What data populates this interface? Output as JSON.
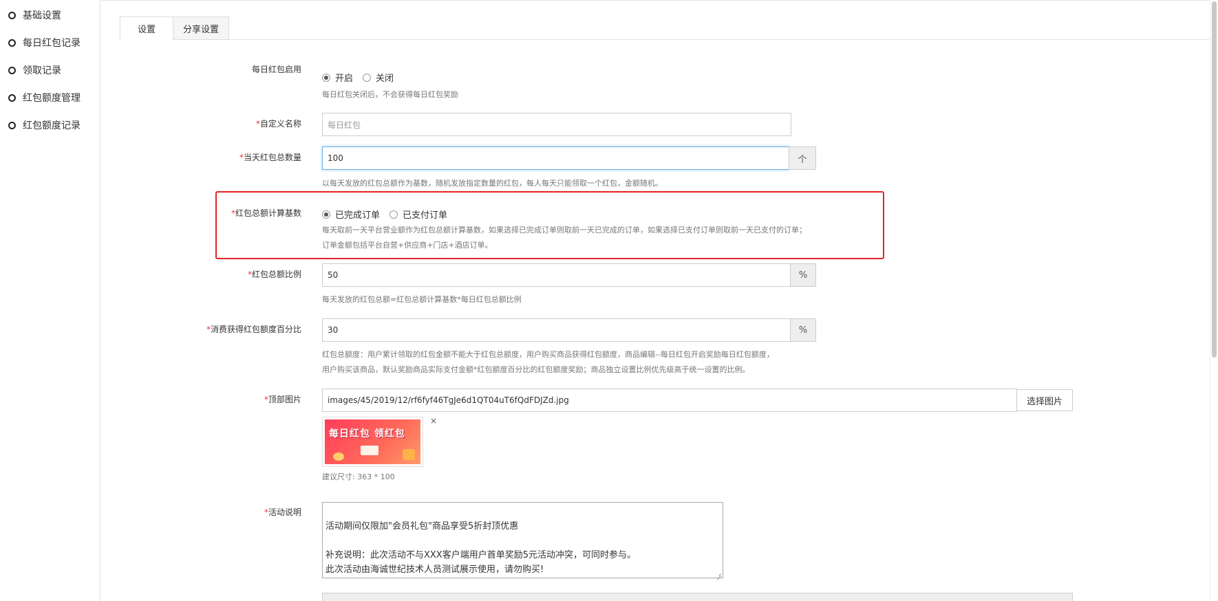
{
  "sidebar": {
    "items": [
      {
        "label": "基础设置"
      },
      {
        "label": "每日红包记录"
      },
      {
        "label": "领取记录"
      },
      {
        "label": "红包额度管理"
      },
      {
        "label": "红包额度记录"
      }
    ]
  },
  "tabs": [
    {
      "label": "设置",
      "active": true
    },
    {
      "label": "分享设置",
      "active": false
    }
  ],
  "form": {
    "daily_enable": {
      "label": "每日红包启用",
      "options": [
        "开启",
        "关闭"
      ],
      "selected": "开启",
      "hint": "每日红包关闭后，不会获得每日红包奖励"
    },
    "custom_name": {
      "label": "自定义名称",
      "placeholder": "每日红包"
    },
    "total_count": {
      "label": "当天红包总数量",
      "value": "100",
      "addon": "个",
      "hint": "以每天发放的红包总额作为基数，随机发放指定数量的红包，每人每天只能领取一个红包，金额随机。"
    },
    "calc_base": {
      "label": "红包总额计算基数",
      "options": [
        "已完成订单",
        "已支付订单"
      ],
      "selected": "已完成订单",
      "hint1": "每天取前一天平台营业额作为红包总额计算基数，如果选择已完成订单则取前一天已完成的订单，如果选择已支付订单则取前一天已支付的订单；",
      "hint2": "订单金额包括平台自营+供应商+门店+酒店订单。"
    },
    "ratio": {
      "label": "红包总额比例",
      "value": "50",
      "addon": "%",
      "hint": "每天发放的红包总额=红包总额计算基数*每日红包总额比例"
    },
    "consume_percent": {
      "label": "消费获得红包额度百分比",
      "value": "30",
      "addon": "%",
      "hint1": "红包总额度：用户累计领取的红包金额不能大于红包总额度，用户购买商品获得红包额度，商品编辑--每日红包开启奖励每日红包额度，",
      "hint2": "用户购买该商品，默认奖励商品实际支付金额*红包额度百分比的红包额度奖励；商品独立设置比例优先级高于统一设置的比例。"
    },
    "top_image": {
      "label": "顶部图片",
      "value": "images/45/2019/12/rf6fyf46TgJe6d1QT04uT6fQdFDJZd.jpg",
      "button": "选择图片",
      "thumb_text": "每日红包 领红包",
      "close": "×",
      "hint": "建议尺寸: 363 * 100"
    },
    "description": {
      "label": "活动说明",
      "value": "活动期间仅限加\"会员礼包\"商品享受5折封顶优惠\n\n补充说明：此次活动不与XXX客户端用户首单奖励5元活动冲突，可同时参与。\n此次活动由海诚世纪技术人员测试展示使用，请勿购买!"
    }
  },
  "colors": {
    "required": "#e4393c",
    "highlight": "#e32424",
    "focus": "#66afe9"
  }
}
